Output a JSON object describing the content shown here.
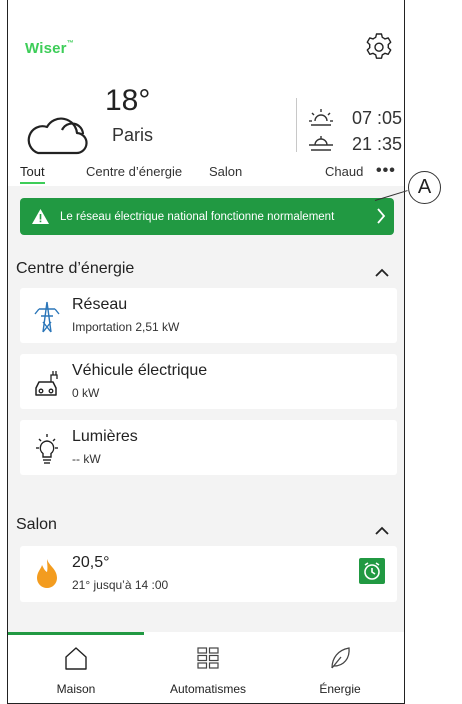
{
  "app": {
    "logo": "Wiser",
    "logo_mark": "™"
  },
  "weather": {
    "temperature": "18°",
    "city": "Paris",
    "sunrise": "07 :05",
    "sunset": "21 :35"
  },
  "tabs": [
    {
      "label": "Tout",
      "active": true
    },
    {
      "label": "Centre d’énergie",
      "active": false
    },
    {
      "label": "Salon",
      "active": false
    },
    {
      "label": "Chaud",
      "active": false
    }
  ],
  "more_label": "•••",
  "banner": {
    "text": "Le réseau électrique national fonctionne normalement",
    "color": "#219942"
  },
  "energy_section": {
    "title": "Centre d’énergie",
    "items": [
      {
        "name": "Réseau",
        "value": "Importation 2,51 kW",
        "icon": "power-pylon-icon"
      },
      {
        "name": "Véhicule électrique",
        "value": "0 kW",
        "icon": "ev-charging-icon"
      },
      {
        "name": "Lumières",
        "value": "-- kW",
        "icon": "lightbulb-icon"
      }
    ]
  },
  "salon_section": {
    "title": "Salon",
    "device": {
      "temperature": "20,5°",
      "schedule": "21° jusqu’à 14 :00",
      "icon": "flame-icon"
    }
  },
  "bottom_nav": [
    {
      "label": "Maison",
      "icon": "home-icon",
      "active": true
    },
    {
      "label": "Automatismes",
      "icon": "grid-icon",
      "active": false
    },
    {
      "label": "Énergie",
      "icon": "leaf-icon",
      "active": false
    }
  ],
  "callout": {
    "label": "A"
  },
  "colors": {
    "accent": "#3dcd58",
    "banner_green": "#219942",
    "flame": "#f39c1f",
    "background": "#f3f3f3"
  }
}
